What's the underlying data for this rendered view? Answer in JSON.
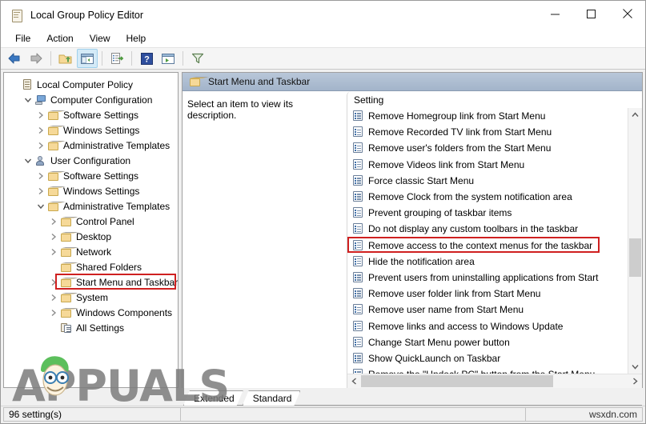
{
  "window": {
    "title": "Local Group Policy Editor",
    "title_icon": "policy-scroll-icon",
    "controls": {
      "minimize": "minimize-icon",
      "maximize": "maximize-icon",
      "close": "close-icon"
    }
  },
  "menubar": {
    "items": [
      "File",
      "Action",
      "View",
      "Help"
    ]
  },
  "toolbar": {
    "buttons": [
      {
        "name": "back-icon",
        "label": "Back"
      },
      {
        "name": "forward-icon",
        "label": "Forward"
      },
      {
        "name": "up-one-level-icon",
        "label": "Up One Level"
      },
      {
        "name": "show-hide-tree-icon",
        "label": "Show/Hide Console Tree",
        "active": true
      },
      {
        "name": "export-list-icon",
        "label": "Export List"
      },
      {
        "name": "help-icon",
        "label": "Help"
      },
      {
        "name": "properties-icon",
        "label": "Properties"
      },
      {
        "name": "filter-icon",
        "label": "Filter"
      }
    ]
  },
  "tree": {
    "nodes": [
      {
        "label": "Local Computer Policy",
        "indent": 0,
        "twisty": "none",
        "icon": "scroll"
      },
      {
        "label": "Computer Configuration",
        "indent": 1,
        "twisty": "expanded",
        "icon": "computer"
      },
      {
        "label": "Software Settings",
        "indent": 2,
        "twisty": "collapsed",
        "icon": "folder"
      },
      {
        "label": "Windows Settings",
        "indent": 2,
        "twisty": "collapsed",
        "icon": "folder"
      },
      {
        "label": "Administrative Templates",
        "indent": 2,
        "twisty": "collapsed",
        "icon": "folder"
      },
      {
        "label": "User Configuration",
        "indent": 1,
        "twisty": "expanded",
        "icon": "user"
      },
      {
        "label": "Software Settings",
        "indent": 2,
        "twisty": "collapsed",
        "icon": "folder"
      },
      {
        "label": "Windows Settings",
        "indent": 2,
        "twisty": "collapsed",
        "icon": "folder"
      },
      {
        "label": "Administrative Templates",
        "indent": 2,
        "twisty": "expanded",
        "icon": "folder"
      },
      {
        "label": "Control Panel",
        "indent": 3,
        "twisty": "collapsed",
        "icon": "folder"
      },
      {
        "label": "Desktop",
        "indent": 3,
        "twisty": "collapsed",
        "icon": "folder"
      },
      {
        "label": "Network",
        "indent": 3,
        "twisty": "collapsed",
        "icon": "folder"
      },
      {
        "label": "Shared Folders",
        "indent": 3,
        "twisty": "none",
        "icon": "folder"
      },
      {
        "label": "Start Menu and Taskbar",
        "indent": 3,
        "twisty": "collapsed",
        "icon": "folder",
        "highlight": true
      },
      {
        "label": "System",
        "indent": 3,
        "twisty": "collapsed",
        "icon": "folder"
      },
      {
        "label": "Windows Components",
        "indent": 3,
        "twisty": "collapsed",
        "icon": "folder"
      },
      {
        "label": "All Settings",
        "indent": 3,
        "twisty": "none",
        "icon": "allsettings"
      }
    ]
  },
  "right_pane": {
    "header_title": "Start Menu and Taskbar",
    "header_icon": "folder-icon",
    "description_placeholder": "Select an item to view its description.",
    "list_column_header": "Setting",
    "settings": [
      {
        "label": "Remove Homegroup link from Start Menu"
      },
      {
        "label": "Remove Recorded TV link from Start Menu"
      },
      {
        "label": "Remove user's folders from the Start Menu"
      },
      {
        "label": "Remove Videos link from Start Menu"
      },
      {
        "label": "Force classic Start Menu"
      },
      {
        "label": "Remove Clock from the system notification area"
      },
      {
        "label": "Prevent grouping of taskbar items"
      },
      {
        "label": "Do not display any custom toolbars in the taskbar"
      },
      {
        "label": "Remove access to the context menus for the taskbar",
        "highlight": true
      },
      {
        "label": "Hide the notification area"
      },
      {
        "label": "Prevent users from uninstalling applications from Start"
      },
      {
        "label": "Remove user folder link from Start Menu"
      },
      {
        "label": "Remove user name from Start Menu"
      },
      {
        "label": "Remove links and access to Windows Update"
      },
      {
        "label": "Change Start Menu power button"
      },
      {
        "label": "Show QuickLaunch on Taskbar"
      },
      {
        "label": "Remove the \"Undock PC\" button from the Start Menu"
      }
    ],
    "scrollbars": {
      "vertical_up": "chevron-up-icon",
      "vertical_down": "chevron-down-icon",
      "horizontal_left": "chevron-left-icon",
      "horizontal_right": "chevron-right-icon"
    }
  },
  "tabs": [
    {
      "label": "Extended",
      "selected": false
    },
    {
      "label": "Standard",
      "selected": true
    }
  ],
  "statusbar": {
    "left": "96 setting(s)",
    "middle": "",
    "right": "wsxdn.com"
  },
  "watermark": {
    "text": "APPUALS"
  },
  "colors": {
    "highlight_red": "#cf2020",
    "header_blue": "#a3b4ca",
    "toolbar_active": "#d4eaf7"
  }
}
